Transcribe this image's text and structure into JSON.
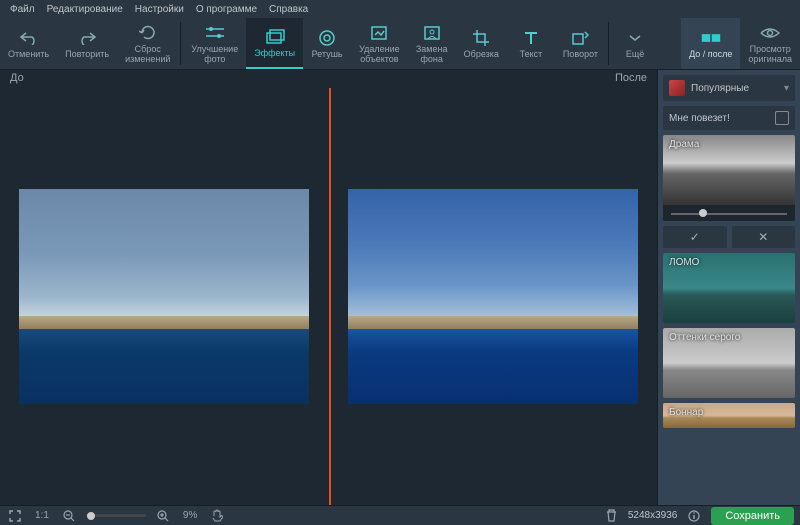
{
  "menu": {
    "file": "Файл",
    "edit": "Редактирование",
    "settings": "Настройки",
    "about": "О программе",
    "help": "Справка"
  },
  "toolbar": {
    "undo": "Отменить",
    "redo": "Повторить",
    "reset": "Сброс\nизменений",
    "enhance": "Улучшение\nфото",
    "effects": "Эффекты",
    "retouch": "Ретушь",
    "remove": "Удаление\nобъектов",
    "bgswap": "Замена\nфона",
    "crop": "Обрезка",
    "text": "Текст",
    "rotate": "Поворот",
    "more": "Ещё",
    "beforeAfter": "До / после",
    "original": "Просмотр\nоригинала"
  },
  "canvas": {
    "before": "До",
    "after": "После"
  },
  "panel": {
    "category": "Популярные",
    "lucky": "Мне повезет!",
    "effects": [
      {
        "name": "Драма"
      },
      {
        "name": "ЛОМО"
      },
      {
        "name": "Оттенки серого"
      },
      {
        "name": "Боннар"
      }
    ]
  },
  "status": {
    "fit": "1:1",
    "zoom": "9%",
    "dims": "5248x3936",
    "save": "Сохранить"
  }
}
